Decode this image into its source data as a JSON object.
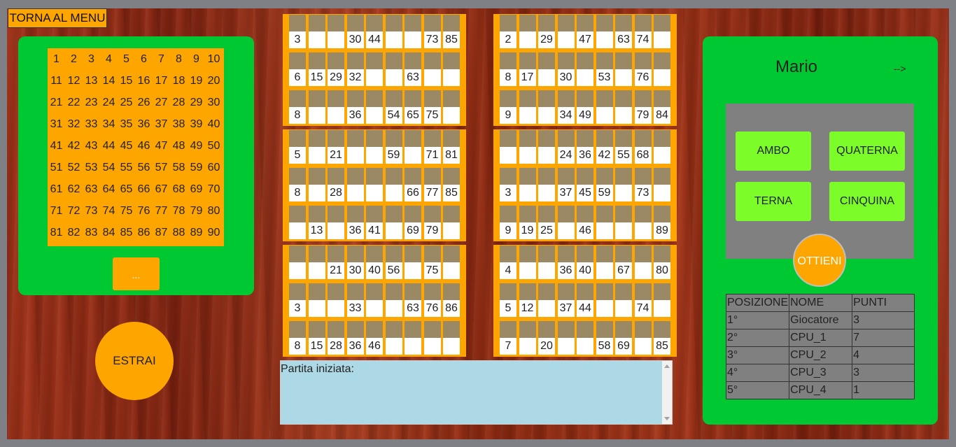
{
  "menu_button": "TORNA AL MENU",
  "tabellone": [
    1,
    2,
    3,
    4,
    5,
    6,
    7,
    8,
    9,
    10,
    11,
    12,
    13,
    14,
    15,
    16,
    17,
    18,
    19,
    20,
    21,
    22,
    23,
    24,
    25,
    26,
    27,
    28,
    29,
    30,
    31,
    32,
    33,
    34,
    35,
    36,
    37,
    38,
    39,
    40,
    41,
    42,
    43,
    44,
    45,
    46,
    47,
    48,
    49,
    50,
    51,
    52,
    53,
    54,
    55,
    56,
    57,
    58,
    59,
    60,
    61,
    62,
    63,
    64,
    65,
    66,
    67,
    68,
    69,
    70,
    71,
    72,
    73,
    74,
    75,
    76,
    77,
    78,
    79,
    80,
    81,
    82,
    83,
    84,
    85,
    86,
    87,
    88,
    89,
    90
  ],
  "dots_button": "...",
  "estrai_button": "ESTRAI",
  "cards": [
    [
      [
        3,
        "",
        "",
        30,
        44,
        "",
        "",
        73,
        85
      ],
      [
        6,
        15,
        29,
        32,
        "",
        "",
        63,
        "",
        ""
      ],
      [
        8,
        "",
        "",
        36,
        "",
        54,
        65,
        75,
        ""
      ]
    ],
    [
      [
        2,
        "",
        29,
        "",
        47,
        "",
        63,
        74,
        ""
      ],
      [
        8,
        17,
        "",
        30,
        "",
        53,
        "",
        76,
        ""
      ],
      [
        9,
        "",
        "",
        34,
        49,
        "",
        "",
        79,
        84
      ]
    ],
    [
      [
        5,
        "",
        21,
        "",
        "",
        59,
        "",
        71,
        81
      ],
      [
        8,
        "",
        28,
        "",
        "",
        "",
        66,
        77,
        85
      ],
      [
        "",
        13,
        "",
        36,
        41,
        "",
        69,
        79,
        ""
      ]
    ],
    [
      [
        "",
        "",
        "",
        24,
        36,
        42,
        55,
        68,
        ""
      ],
      [
        3,
        "",
        "",
        37,
        45,
        59,
        "",
        73,
        ""
      ],
      [
        9,
        19,
        25,
        "",
        46,
        "",
        "",
        "",
        89
      ]
    ],
    [
      [
        "",
        "",
        21,
        30,
        40,
        56,
        "",
        75,
        ""
      ],
      [
        3,
        "",
        "",
        33,
        "",
        "",
        63,
        76,
        86
      ],
      [
        8,
        15,
        28,
        36,
        46,
        "",
        "",
        "",
        ""
      ]
    ],
    [
      [
        4,
        "",
        "",
        36,
        40,
        "",
        67,
        "",
        80
      ],
      [
        5,
        12,
        "",
        37,
        44,
        "",
        "",
        74,
        ""
      ],
      [
        7,
        "",
        20,
        "",
        "",
        58,
        69,
        "",
        85
      ]
    ]
  ],
  "log": {
    "text": "Partita iniziata:"
  },
  "player": {
    "name": "Mario",
    "arrow": "-->"
  },
  "prizes": {
    "ambo": "AMBO",
    "quaterna": "QUATERNA",
    "terna": "TERNA",
    "cinquina": "CINQUINA"
  },
  "ottieni_button": "OTTIENI",
  "ranking": {
    "headers": [
      "POSIZIONE",
      "NOME",
      "PUNTI"
    ],
    "rows": [
      {
        "pos": "1°",
        "name": "Giocatore",
        "points": "3"
      },
      {
        "pos": "2°",
        "name": "CPU_1",
        "points": "7"
      },
      {
        "pos": "3°",
        "name": "CPU_2",
        "points": "4"
      },
      {
        "pos": "4°",
        "name": "CPU_3",
        "points": "3"
      },
      {
        "pos": "5°",
        "name": "CPU_4",
        "points": "1"
      }
    ]
  },
  "colors": {
    "orange": "#ffa500",
    "green": "#00c832",
    "light_green": "#7cfc28",
    "grey": "#808080",
    "log_blue": "#add8e6"
  }
}
